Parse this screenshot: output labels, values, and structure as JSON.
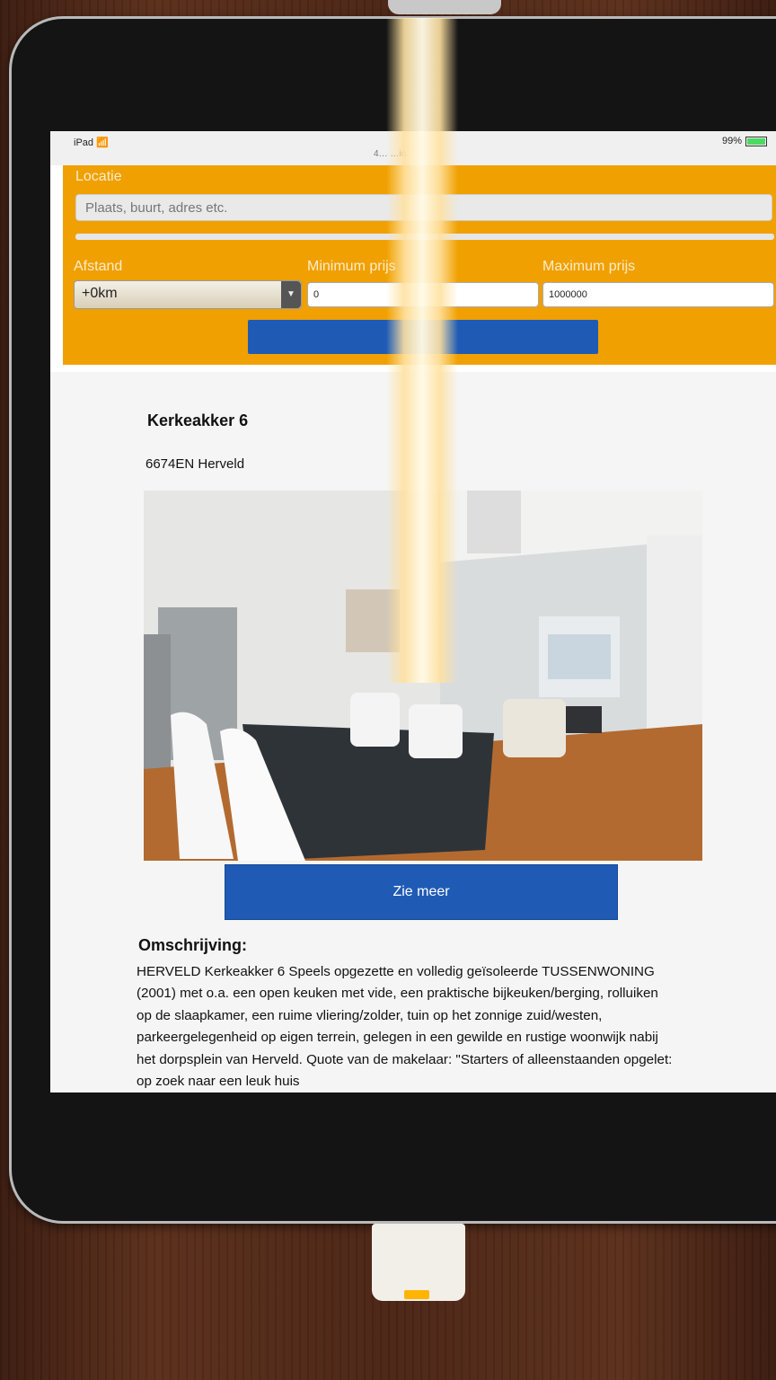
{
  "statusbar": {
    "device": "iPad",
    "title": "4…                    …io",
    "battery": "99%"
  },
  "search": {
    "location_label": "Locatie",
    "location_placeholder": "Plaats, buurt, adres etc.",
    "distance_label": "Afstand",
    "distance_value": "+0km",
    "min_price_label": "Minimum prijs",
    "min_price_value": "0",
    "max_price_label": "Maximum prijs",
    "max_price_value": "1000000",
    "search_button_label": ""
  },
  "listing": {
    "title": "Kerkeakker 6",
    "postcode_city": "6674EN Herveld",
    "photo": "living-room-photo",
    "more_button": "Zie meer",
    "description_title": "Omschrijving:",
    "description": "HERVELD Kerkeakker 6 Speels opgezette en volledig geïsoleerde TUSSENWONING (2001) met o.a. een open keuken met vide, een praktische bijkeuken/berging, rolluiken op de slaapkamer, een ruime vliering/zolder, tuin op het zonnige zuid/westen, parkeergelegenheid op eigen terrein, gelegen in een gewilde en rustige woonwijk nabij het dorpsplein van Herveld. Quote van de makelaar: \"Starters of alleenstaanden opgelet: op zoek naar een leuk huis"
  },
  "colors": {
    "accent": "#f0a000",
    "button": "#1f5bb5"
  }
}
